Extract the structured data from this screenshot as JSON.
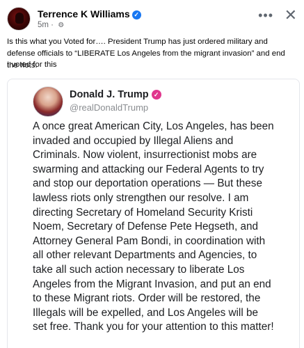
{
  "post": {
    "author": "Terrence K Williams",
    "time": "5m",
    "text": "Is this what you Voted for…. President Trump has just ordered military and defense officials to “LIBERATE Los Angeles from the migrant invasion” and end the riots.",
    "text2": "I voted for this"
  },
  "icons": {
    "verified": "verified-badge-icon",
    "privacy": "gear-icon",
    "more": "more-horizontal-icon",
    "close": "close-icon"
  },
  "embed": {
    "name": "Donald J. Trump",
    "handle": "@realDonaldTrump",
    "body": "A once great American City, Los Angeles, has been invaded and occupied by Illegal Aliens and Criminals.  Now violent, insurrectionist mobs are swarming and attacking our Federal Agents to try and stop our deportation operations — But these lawless riots only strengthen our resolve. I am directing Secretary of Homeland Security Kristi Noem, Secretary of Defense Pete Hegseth, and Attorney General Pam Bondi, in coordination with all other relevant Departments and Agencies, to take all such action necessary to liberate Los Angeles from the Migrant Invasion, and put an end to these Migrant riots. Order will be restored, the Illegals will be expelled, and Los Angeles will be set free. Thank you for your attention to this matter!"
  },
  "colors": {
    "fb_blue": "#1877f2",
    "truth_badge": "#e0368d",
    "secondary_text": "#65676b"
  }
}
